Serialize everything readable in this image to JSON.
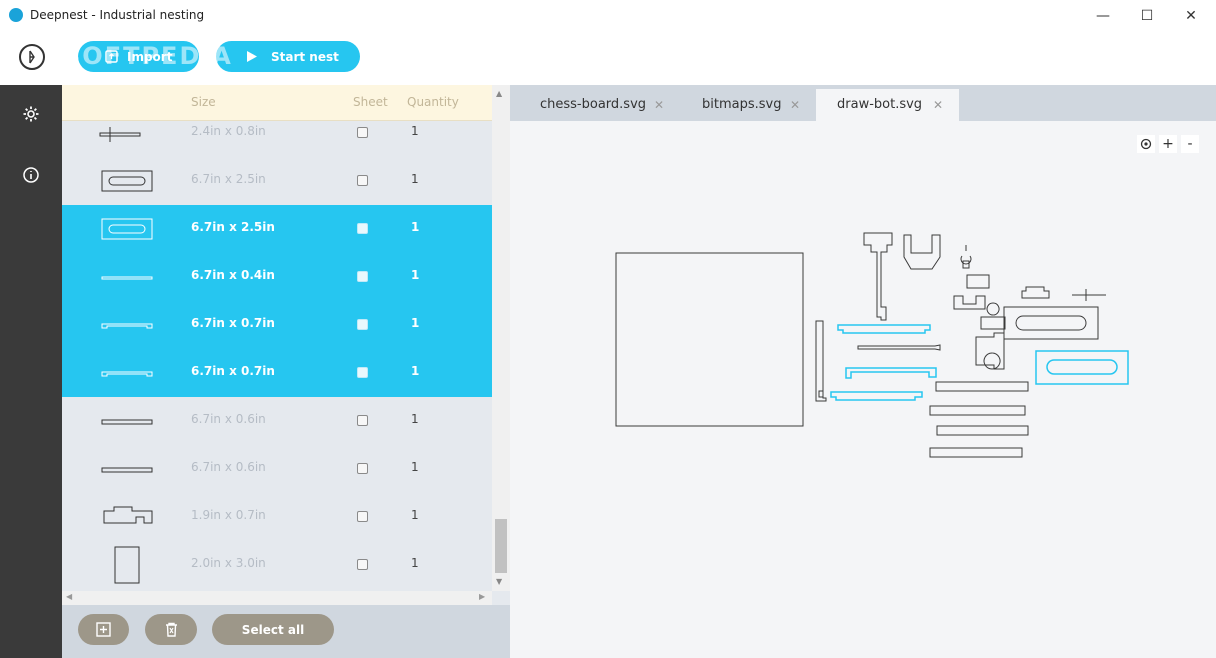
{
  "window": {
    "title": "Deepnest - Industrial nesting",
    "minimize_glyph": "—",
    "maximize_glyph": "☐",
    "close_glyph": "✕"
  },
  "toolbar": {
    "import_label": "Import",
    "start_label": "Start nest",
    "watermark": "SOFTPEDIA"
  },
  "accent_color": "#26c6f0",
  "table": {
    "headers": {
      "size": "Size",
      "sheet": "Sheet",
      "quantity": "Quantity"
    },
    "rows": [
      {
        "size": "2.4in x 0.8in",
        "quantity": "1",
        "selected": false
      },
      {
        "size": "6.7in x 2.5in",
        "quantity": "1",
        "selected": false
      },
      {
        "size": "6.7in x 2.5in",
        "quantity": "1",
        "selected": true
      },
      {
        "size": "6.7in x 0.4in",
        "quantity": "1",
        "selected": true
      },
      {
        "size": "6.7in x 0.7in",
        "quantity": "1",
        "selected": true
      },
      {
        "size": "6.7in x 0.7in",
        "quantity": "1",
        "selected": true
      },
      {
        "size": "6.7in x 0.6in",
        "quantity": "1",
        "selected": false
      },
      {
        "size": "6.7in x 0.6in",
        "quantity": "1",
        "selected": false
      },
      {
        "size": "1.9in x 0.7in",
        "quantity": "1",
        "selected": false
      },
      {
        "size": "2.0in x 3.0in",
        "quantity": "1",
        "selected": false
      }
    ]
  },
  "bottom": {
    "select_all_label": "Select all"
  },
  "tabs": [
    {
      "label": "chess-board.svg",
      "active": false
    },
    {
      "label": "bitmaps.svg",
      "active": false
    },
    {
      "label": "draw-bot.svg",
      "active": true
    }
  ],
  "tab_close_glyph": "✕",
  "zoom": {
    "plus": "+",
    "minus": "-"
  }
}
